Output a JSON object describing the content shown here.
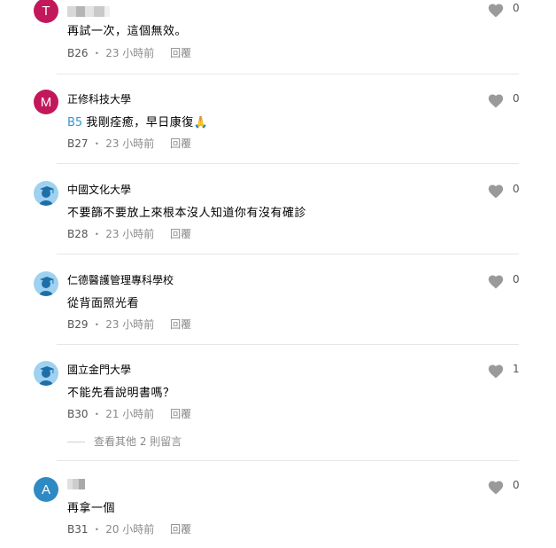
{
  "comments": [
    {
      "avatar_letter": "T",
      "avatar_color": "#c2185b",
      "author": "",
      "mention": "",
      "content": "再試一次，這個無效。",
      "floor": "B26",
      "time": "23 小時前",
      "reply": "回覆",
      "likes": "0"
    },
    {
      "avatar_letter": "M",
      "avatar_color": "#c2185b",
      "author": "正修科技大學",
      "mention": "B5",
      "content": "我剛痊癒，早日康復🙏",
      "floor": "B27",
      "time": "23 小時前",
      "reply": "回覆",
      "likes": "0"
    },
    {
      "avatar_icon": "school-avatar-icon",
      "author": "中國文化大學",
      "mention": "",
      "content": "不要篩不要放上來根本沒人知道你有沒有確診",
      "floor": "B28",
      "time": "23 小時前",
      "reply": "回覆",
      "likes": "0"
    },
    {
      "avatar_icon": "school-avatar-icon",
      "author": "仁德醫護管理專科學校",
      "mention": "",
      "content": "從背面照光看",
      "floor": "B29",
      "time": "23 小時前",
      "reply": "回覆",
      "likes": "0"
    },
    {
      "avatar_icon": "school-avatar-icon",
      "author": "國立金門大學",
      "mention": "",
      "content": "不能先看說明書嗎？",
      "floor": "B30",
      "time": "21 小時前",
      "reply": "回覆",
      "likes": "1",
      "more_replies": "查看其他 2 則留言"
    },
    {
      "avatar_letter": "A",
      "avatar_color": "#2f8ac4",
      "author": "",
      "mention": "",
      "content": "再拿一個",
      "floor": "B31",
      "time": "20 小時前",
      "reply": "回覆",
      "likes": "0"
    }
  ],
  "colors": {
    "mention": "#3397cf",
    "heart": "#9a9a9a",
    "divider": "#e6e6e6",
    "school_avatar": "#9fd1f0"
  }
}
